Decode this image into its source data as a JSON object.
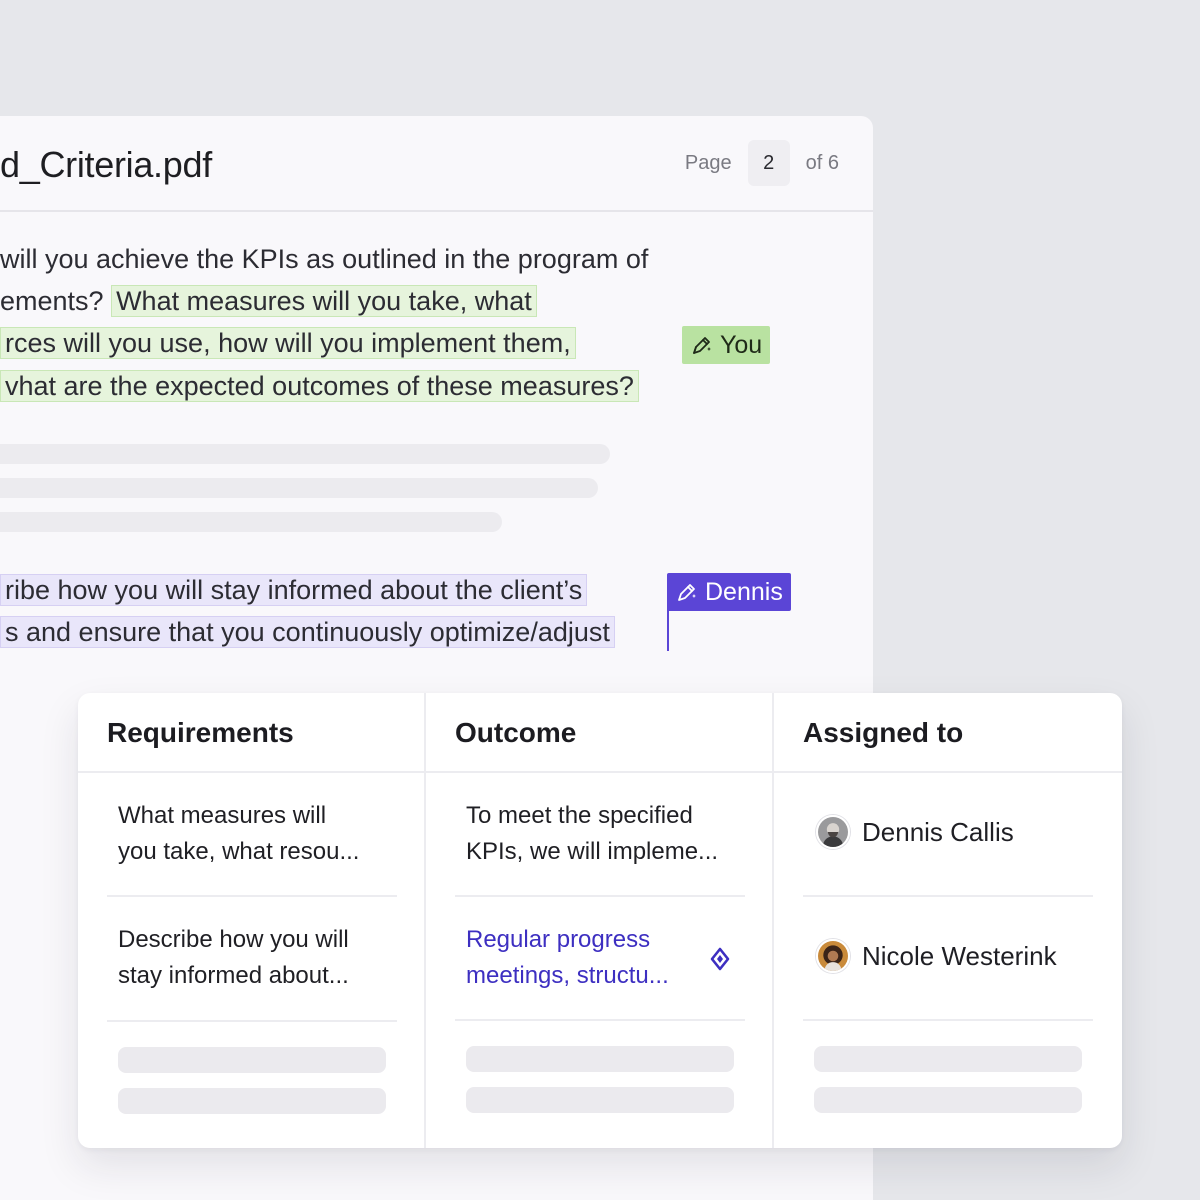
{
  "document": {
    "title": "d_Criteria.pdf",
    "pager": {
      "label": "Page",
      "current": "2",
      "total_text": "of 6"
    },
    "lines": [
      "will you achieve the KPIs as outlined in the program of",
      "ements?",
      "What measures will you take, what",
      "rces will you use, how will you implement them,",
      "vhat are the expected outcomes of these measures?",
      "ribe how you will stay informed about the client’s",
      "s and ensure that you continuously optimize/adjust"
    ],
    "collaborators": {
      "you": "You",
      "dennis": "Dennis"
    },
    "colors": {
      "you_highlight": "#e6f4dc",
      "you_tag": "#b9e2a1",
      "dennis_highlight": "#e9e6fa",
      "dennis_tag": "#5b45d6"
    }
  },
  "table": {
    "columns": [
      "Requirements",
      "Outcome",
      "Assigned to"
    ],
    "rows": [
      {
        "requirement": [
          "What measures will",
          "you take, what resou..."
        ],
        "outcome": [
          "To meet the specified",
          "KPIs, we will impleme..."
        ],
        "assignee": "Dennis Callis"
      },
      {
        "requirement": [
          "Describe how you will",
          "stay informed about..."
        ],
        "outcome": [
          "Regular progress",
          "meetings, structu..."
        ],
        "assignee": "Nicole Westerink"
      }
    ],
    "link_color": "#3d2fc1"
  }
}
